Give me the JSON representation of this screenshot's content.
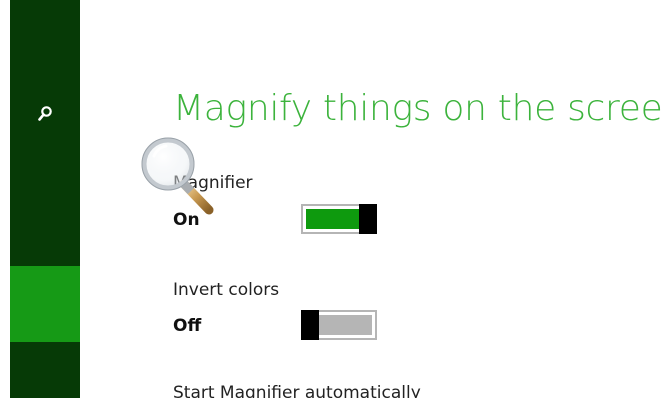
{
  "rail": {
    "search_icon": "search-icon"
  },
  "page_title": "Magnify things on the screen",
  "settings": [
    {
      "label": "Magnifier",
      "state": "On",
      "on": true
    },
    {
      "label": "Invert colors",
      "state": "Off",
      "on": false
    }
  ],
  "next_setting_label": "Start Magnifier automatically",
  "cursor_icon": "magnifier-cursor-icon",
  "colors": {
    "rail": "#063a06",
    "rail_selected": "#169a16",
    "title": "#3cb33c",
    "toggle_on": "#0e9a0e",
    "toggle_off": "#b5b5b5"
  }
}
